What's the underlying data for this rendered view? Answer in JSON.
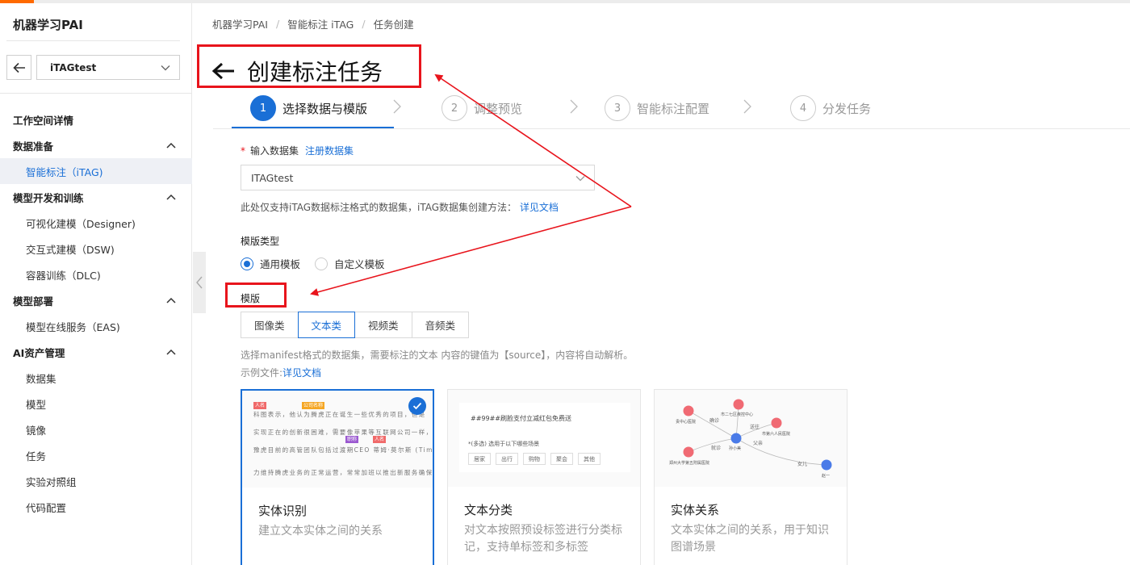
{
  "app": {
    "title": "机器学习PAI"
  },
  "workspace": {
    "name": "iTAGtest"
  },
  "sidebar": {
    "items": [
      {
        "label": "工作空间详情",
        "type": "group"
      },
      {
        "label": "数据准备",
        "type": "group",
        "expandable": true
      },
      {
        "label": "智能标注（iTAG)",
        "type": "sub",
        "active": true
      },
      {
        "label": "模型开发和训练",
        "type": "group",
        "expandable": true
      },
      {
        "label": "可视化建模（Designer)",
        "type": "sub"
      },
      {
        "label": "交互式建模（DSW)",
        "type": "sub"
      },
      {
        "label": "容器训练（DLC)",
        "type": "sub"
      },
      {
        "label": "模型部署",
        "type": "group",
        "expandable": true
      },
      {
        "label": "模型在线服务（EAS)",
        "type": "sub"
      },
      {
        "label": "AI资产管理",
        "type": "group",
        "expandable": true
      },
      {
        "label": "数据集",
        "type": "sub"
      },
      {
        "label": "模型",
        "type": "sub"
      },
      {
        "label": "镜像",
        "type": "sub"
      },
      {
        "label": "任务",
        "type": "sub"
      },
      {
        "label": "实验对照组",
        "type": "sub"
      },
      {
        "label": "代码配置",
        "type": "sub"
      }
    ]
  },
  "breadcrumb": [
    "机器学习PAI",
    "智能标注 iTAG",
    "任务创建"
  ],
  "page": {
    "title": "创建标注任务"
  },
  "steps": [
    {
      "num": "1",
      "label": "选择数据与模版",
      "active": true
    },
    {
      "num": "2",
      "label": "调整预览"
    },
    {
      "num": "3",
      "label": "智能标注配置"
    },
    {
      "num": "4",
      "label": "分发任务"
    }
  ],
  "form": {
    "dataset_label": "输入数据集",
    "register_link": "注册数据集",
    "dataset_value": "ITAGtest",
    "dataset_hint": "此处仅支持iTAG数据标注格式的数据集，iTAG数据集创建方法：",
    "doc_link": "详见文档",
    "template_type_label": "模版类型",
    "radio_general": "通用模板",
    "radio_custom": "自定义模板",
    "template_label": "模版",
    "tabs": [
      "图像类",
      "文本类",
      "视频类",
      "音频类"
    ],
    "active_tab": "文本类",
    "manifest_hint": "选择manifest格式的数据集，需要标注的文本 内容的键值为【source】，内容将自动解析。",
    "example_prefix": "示例文件:",
    "example_link": "详见文档"
  },
  "cards": [
    {
      "title": "实体识别",
      "desc": "建立文本实体之间的关系",
      "selected": true,
      "preview": {
        "lines": [
          "科图表示，他认为腾虎正在诞生一些优秀的项目，但是",
          "实现正在的创新很困难，需要像苹果等互联网公司一样，从",
          "豫虎目前的高管团队包括过渡期CEO 蒂姆·莫尔斯 (Tim",
          "力维持腾虎业务的正常运营，常常加班以推出新服务确保能"
        ],
        "tags": [
          "人名",
          "公司名称",
          "职称",
          "人名"
        ]
      }
    },
    {
      "title": "文本分类",
      "desc": "对文本按照预设标签进行分类标记，支持单标签和多标签",
      "selected": false,
      "preview": {
        "heading": "##99##刷脸支付立减红包免费送",
        "question": "*(多选) 选用于以下哪些场景",
        "options": [
          "居家",
          "出行",
          "购物",
          "聚会",
          "其他"
        ]
      }
    },
    {
      "title": "实体关系",
      "desc": "文本实体之间的关系，用于知识图谱场景",
      "selected": false,
      "preview": {
        "nodes": [
          "贵中心医院",
          "市二七区疾控中心",
          "市第六人民医院",
          "郑州大学第五附属医院",
          "孙小美",
          "赵一"
        ],
        "edges": [
          "确诊",
          "就诊",
          "送往",
          "父亲",
          "女儿"
        ]
      }
    }
  ],
  "colors": {
    "accent": "#1a6fd6",
    "annotation_red": "#e8141c",
    "brand_orange": "#ff6a00"
  }
}
